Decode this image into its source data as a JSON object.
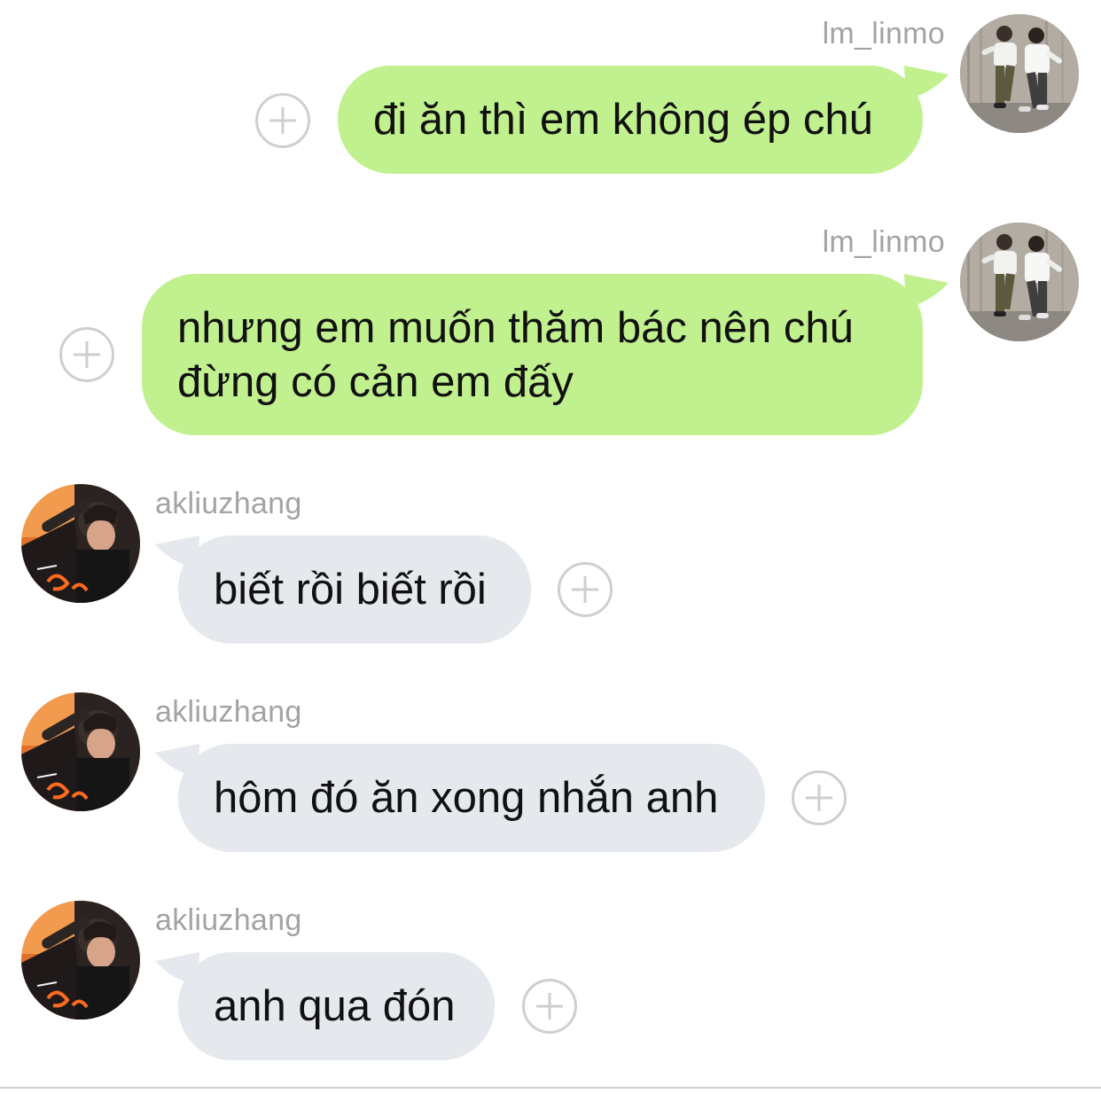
{
  "messages": [
    {
      "direction": "outgoing",
      "sender": "lm_linmo",
      "text": "đi ăn thì em không ép chú",
      "avatar_icon": "profile-photo-two-people"
    },
    {
      "direction": "outgoing",
      "sender": "lm_linmo",
      "text": "nhưng em muốn thăm bác nên chú đừng có cản em đấy",
      "avatar_icon": "profile-photo-two-people"
    },
    {
      "direction": "incoming",
      "sender": "akliuzhang",
      "text": "biết rồi biết rồi",
      "avatar_icon": "profile-photo-person-orange"
    },
    {
      "direction": "incoming",
      "sender": "akliuzhang",
      "text": "hôm đó ăn xong nhắn anh",
      "avatar_icon": "profile-photo-person-orange"
    },
    {
      "direction": "incoming",
      "sender": "akliuzhang",
      "text": "anh qua đón",
      "avatar_icon": "profile-photo-person-orange"
    }
  ],
  "icons": {
    "react_button": "plus-circle-icon"
  },
  "colors": {
    "outgoing_bubble": "#c1f18e",
    "incoming_bubble": "#e5e8ec",
    "username_text": "#a3a3a3",
    "plus_icon": "#cfcfcf"
  }
}
